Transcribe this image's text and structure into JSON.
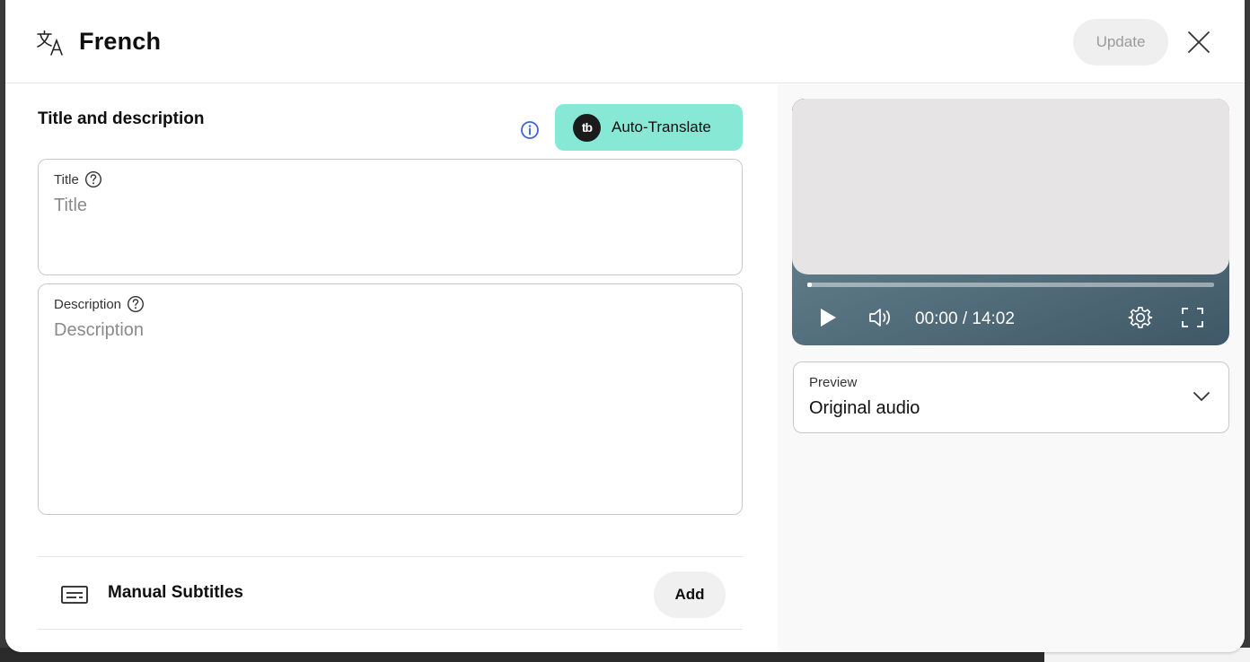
{
  "header": {
    "title": "French",
    "update_label": "Update"
  },
  "main": {
    "section_title": "Title and description",
    "auto_translate": {
      "logo_text": "tb",
      "label": "Auto-Translate",
      "color": "#88e8d6"
    },
    "title_field": {
      "label": "Title",
      "placeholder": "Title",
      "value": ""
    },
    "description_field": {
      "label": "Description",
      "placeholder": "Description",
      "value": ""
    },
    "subtitles": {
      "label": "Manual Subtitles",
      "add_label": "Add"
    }
  },
  "player": {
    "time": "00:00 / 14:02",
    "progress_fraction": 0
  },
  "preview": {
    "label": "Preview",
    "selected": "Original audio"
  },
  "icons": {
    "language": "translate-icon",
    "close": "close-icon",
    "info": "info-icon",
    "help": "help-circle-icon",
    "subtitles": "subtitles-icon",
    "play": "play-icon",
    "volume": "volume-icon",
    "settings": "gear-icon",
    "fullscreen": "fullscreen-icon",
    "dropdown": "chevron-down-icon"
  },
  "colors": {
    "accent_info": "#3e64d8",
    "update_disabled_text": "#9a9a9a"
  }
}
